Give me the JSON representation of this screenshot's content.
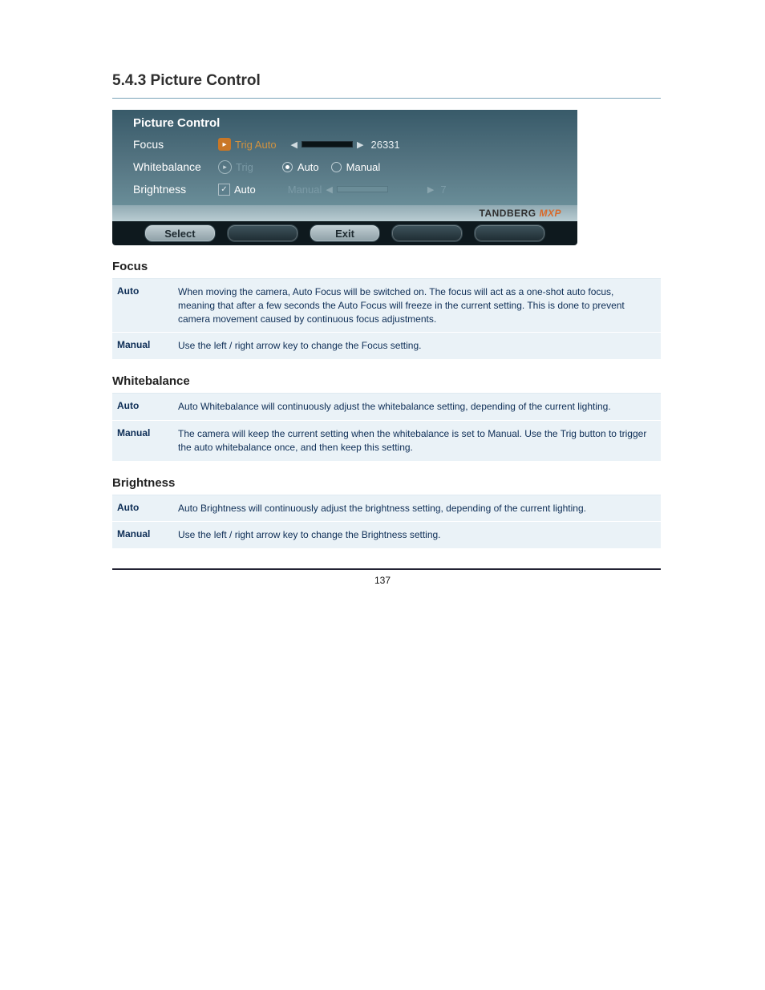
{
  "heading": "5.4.3 Picture Control",
  "panel": {
    "title": "Picture Control",
    "focus": {
      "label": "Focus",
      "trig": "Trig Auto",
      "value": "26331"
    },
    "whitebalance": {
      "label": "Whitebalance",
      "trig": "Trig",
      "optAuto": "Auto",
      "optManual": "Manual"
    },
    "brightness": {
      "label": "Brightness",
      "chk": "Auto",
      "manual": "Manual",
      "value": "7"
    },
    "brand": "TANDBERG",
    "brandSuffix": "MXP",
    "btnSelect": "Select",
    "btnExit": "Exit"
  },
  "sections": {
    "focus": {
      "title": "Focus",
      "rows": [
        {
          "term": "Auto",
          "def": "When moving the camera, Auto Focus will be switched on. The focus will act as a one-shot auto focus, meaning that after a few seconds the Auto Focus will freeze in the current setting. This is done to prevent camera movement caused by continuous focus adjustments."
        },
        {
          "term": "Manual",
          "def": "Use the left / right arrow key to change the Focus setting."
        }
      ]
    },
    "wb": {
      "title": "Whitebalance",
      "rows": [
        {
          "term": "Auto",
          "def": "Auto Whitebalance will continuously adjust the whitebalance setting, depending of the current lighting."
        },
        {
          "term": "Manual",
          "def": "The camera will keep the current setting when the whitebalance is set to Manual. Use the Trig button to trigger the auto whitebalance once, and then keep this setting."
        }
      ]
    },
    "bright": {
      "title": "Brightness",
      "rows": [
        {
          "term": "Auto",
          "def": "Auto Brightness will continuously adjust the brightness setting, depending of the current lighting."
        },
        {
          "term": "Manual",
          "def": "Use the left / right arrow key to change the Brightness setting."
        }
      ]
    }
  },
  "pageNumber": "137"
}
